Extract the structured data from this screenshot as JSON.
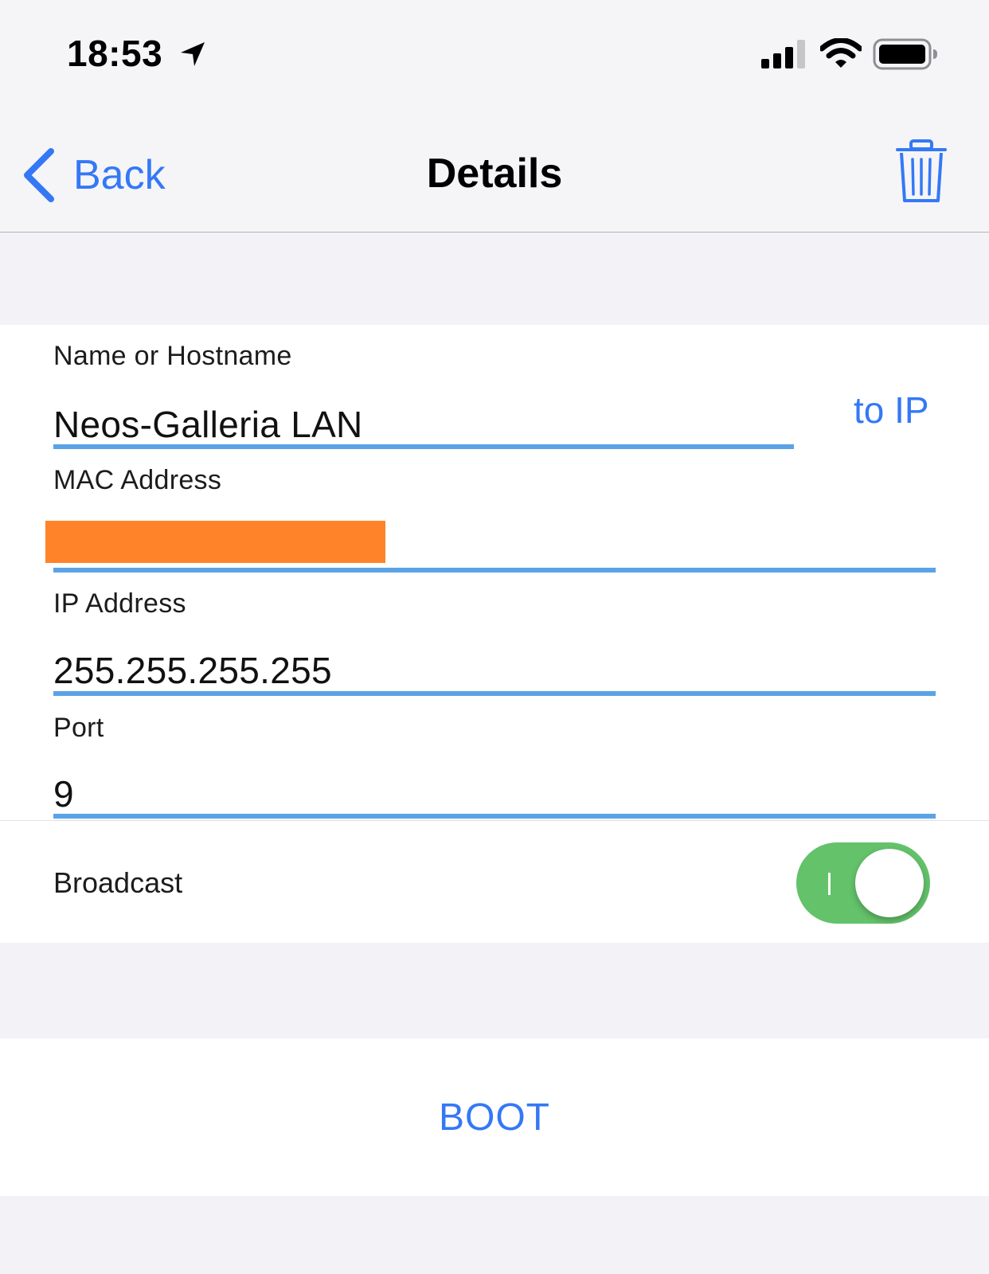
{
  "status_bar": {
    "time": "18:53",
    "icons": [
      "location-arrow-icon",
      "cellular-signal-icon",
      "wifi-icon",
      "battery-icon"
    ]
  },
  "nav": {
    "back_label": "Back",
    "title": "Details",
    "trash_icon": "trash-icon"
  },
  "form": {
    "name_label": "Name or Hostname",
    "name_value": "Neos-Galleria LAN",
    "to_ip_label": "to IP",
    "mac_label": "MAC Address",
    "mac_value": "",
    "ip_label": "IP Address",
    "ip_value": "255.255.255.255",
    "port_label": "Port",
    "port_value": "9",
    "broadcast_label": "Broadcast",
    "broadcast_on": true
  },
  "boot_label": "BOOT",
  "colors": {
    "accent": "#3478f6",
    "underline": "#5aa3e6",
    "toggle_on": "#63c26a",
    "redaction": "#ff8329",
    "background": "#f2f2f7"
  }
}
